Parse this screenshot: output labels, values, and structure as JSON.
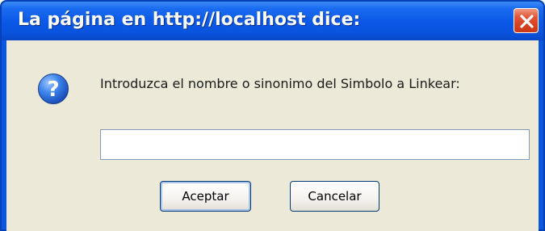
{
  "window": {
    "title": "La página en http://localhost dice:",
    "close_icon": "close-icon"
  },
  "dialog": {
    "icon": "question-icon",
    "message": "Introduzca el nombre o sinonimo del Simbolo a Linkear:",
    "input_value": ""
  },
  "buttons": {
    "accept_label": "Aceptar",
    "cancel_label": "Cancelar"
  },
  "colors": {
    "titlebar": "#0a58e6",
    "client_background": "#ece9d8",
    "close_button": "#d6401f",
    "question_icon": "#2c6fd8"
  }
}
